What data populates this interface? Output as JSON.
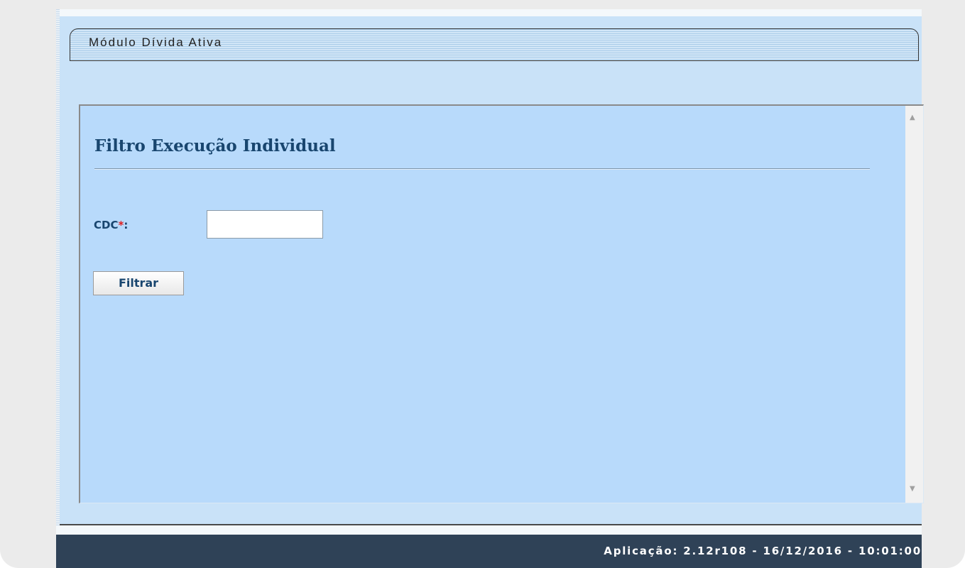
{
  "module": {
    "title": "Módulo Dívida Ativa"
  },
  "form": {
    "title": "Filtro Execução Individual",
    "cdc_label": "CDC",
    "required_mark": "*",
    "label_suffix": ":",
    "cdc_value": "",
    "filter_button_label": "Filtrar"
  },
  "footer": {
    "text": "Aplicação: 2.12r108 - 16/12/2016 - 10:01:00"
  },
  "colors": {
    "panel_background": "#b8dafb",
    "heading_text": "#19466f",
    "required_mark": "#e02020",
    "footer_background": "#2f4257"
  },
  "icons": {
    "scroll_up": "scroll-up-arrow-icon",
    "scroll_down": "scroll-down-arrow-icon"
  }
}
